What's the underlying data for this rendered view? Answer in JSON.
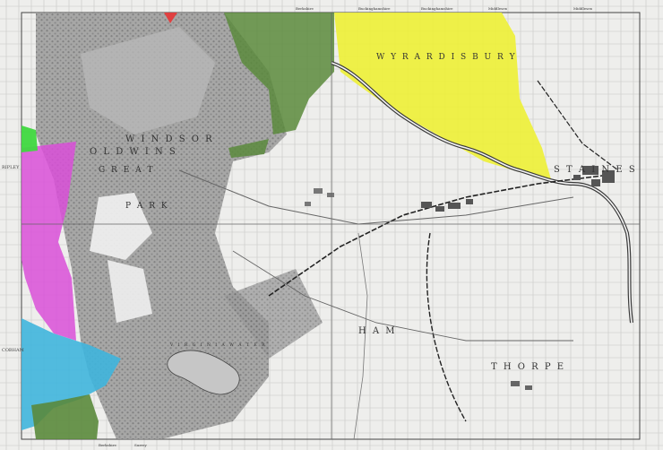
{
  "map": {
    "places": {
      "windsor": "W I N D S O R",
      "old_windsor": "O L D   W I N S",
      "great": "G R E A T",
      "park": "P A R K",
      "wyrardisbury": "W Y R A R D I S B U R Y",
      "staines": "S T A I N E S",
      "egham": "H A M",
      "thorpe": "T H O R P E",
      "virginia_water": "V I R G I N I A   W A T E R"
    },
    "margin": {
      "ripley": "RIPLEY",
      "cobham": "COBHAM",
      "header_left": "Berkshire",
      "header_mid1": "Buckinghamshire",
      "header_mid2": "Buckinghamshire",
      "header_mid3": "Middlesex",
      "header_right": "Middlesex",
      "footer_left": "Berkshire",
      "footer_mid": "Surrey"
    },
    "colors": {
      "yellow": "#eef03a",
      "olive": "#5a8a3c",
      "magenta": "#d94fd8",
      "cyan": "#3fb5dd",
      "green_bright": "#3fd840",
      "red": "#e33b3b",
      "grey_dark": "#8c8c8c",
      "grey_mid": "#b4b4b4",
      "paper": "#f1f1ef",
      "line": "#555555",
      "river": "#3a3a3a"
    }
  }
}
